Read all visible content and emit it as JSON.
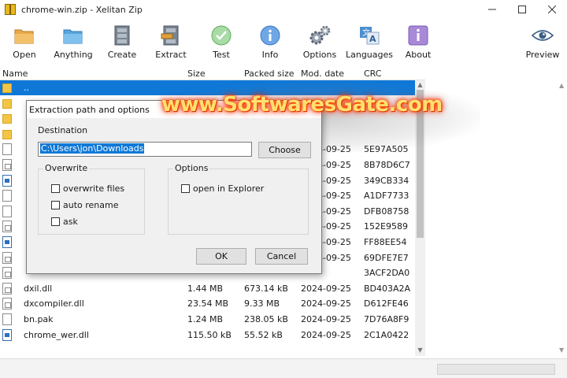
{
  "window": {
    "title": "chrome-win.zip - Xelitan Zip",
    "controls": [
      "minimize-icon",
      "maximize-icon",
      "close-icon"
    ]
  },
  "toolbar": {
    "buttons": [
      {
        "label": "Open",
        "icon": "folder-open-icon"
      },
      {
        "label": "Anything",
        "icon": "folder-anything-icon"
      },
      {
        "label": "Create",
        "icon": "cabinet-create-icon"
      },
      {
        "label": "Extract",
        "icon": "cabinet-extract-icon"
      },
      {
        "label": "Test",
        "icon": "check-circle-icon"
      },
      {
        "label": "Info",
        "icon": "info-icon"
      },
      {
        "label": "Options",
        "icon": "gears-icon"
      },
      {
        "label": "Languages",
        "icon": "translate-icon"
      },
      {
        "label": "About",
        "icon": "about-icon"
      },
      {
        "label": "Preview",
        "icon": "eye-icon"
      }
    ]
  },
  "columns": [
    "Name",
    "Size",
    "Packed size",
    "Mod. date",
    "CRC"
  ],
  "files": [
    {
      "name": "..",
      "size": "",
      "packed": "",
      "date": "",
      "crc": "",
      "type": "folder",
      "selected": true
    },
    {
      "name": "",
      "size": "",
      "packed": "",
      "date": "",
      "crc": "",
      "type": "folder"
    },
    {
      "name": "",
      "size": "",
      "packed": "",
      "date": "",
      "crc": "",
      "type": "folder"
    },
    {
      "name": "",
      "size": "",
      "packed": "",
      "date": "",
      "crc": "",
      "type": "folder"
    },
    {
      "name": "",
      "size": "",
      "packed": "",
      "date": "2024-09-25",
      "crc": "5E97A505",
      "type": "file"
    },
    {
      "name": "",
      "size": "",
      "packed": "",
      "date": "2024-09-25",
      "crc": "8B78D6C7",
      "type": "dll"
    },
    {
      "name": "",
      "size": "",
      "packed": "",
      "date": "2024-09-25",
      "crc": "349CB334",
      "type": "exe"
    },
    {
      "name": "",
      "size": "",
      "packed": "",
      "date": "2024-09-25",
      "crc": "A1DF7733",
      "type": "file"
    },
    {
      "name": "",
      "size": "",
      "packed": "",
      "date": "2024-09-25",
      "crc": "DFB08758",
      "type": "file"
    },
    {
      "name": "",
      "size": "",
      "packed": "",
      "date": "2024-09-25",
      "crc": "152E9589",
      "type": "dll"
    },
    {
      "name": "",
      "size": "",
      "packed": "",
      "date": "2024-09-25",
      "crc": "FF88EE54",
      "type": "exe"
    },
    {
      "name": "",
      "size": "",
      "packed": "",
      "date": "2024-09-25",
      "crc": "69DFE7E7",
      "type": "dll"
    },
    {
      "name": "",
      "size": "",
      "packed": "",
      "date": "",
      "crc": "3ACF2DA0",
      "type": "dll"
    },
    {
      "name": "dxil.dll",
      "size": "1.44 MB",
      "packed": "673.14 kB",
      "date": "2024-09-25",
      "crc": "BD403A2A",
      "type": "dll"
    },
    {
      "name": "dxcompiler.dll",
      "size": "23.54 MB",
      "packed": "9.33 MB",
      "date": "2024-09-25",
      "crc": "D612FE46",
      "type": "dll"
    },
    {
      "name": "bn.pak",
      "size": "1.24 MB",
      "packed": "238.05 kB",
      "date": "2024-09-25",
      "crc": "7D76A8F9",
      "type": "file"
    },
    {
      "name": "chrome_wer.dll",
      "size": "115.50 kB",
      "packed": "55.52 kB",
      "date": "2024-09-25",
      "crc": "2C1A0422",
      "type": "exe"
    }
  ],
  "dialog": {
    "title": "Extraction path and options",
    "destination_label": "Destination",
    "path_value": "C:\\Users\\jon\\Downloads",
    "choose_label": "Choose",
    "overwrite": {
      "title": "Overwrite",
      "options": [
        "overwrite files",
        "auto rename",
        "ask"
      ]
    },
    "options": {
      "title": "Options",
      "items": [
        "open in Explorer"
      ]
    },
    "ok_label": "OK",
    "cancel_label": "Cancel"
  },
  "watermark": "www.SoftwaresGate.com",
  "colors": {
    "selection": "#0f78d7",
    "dialog_bg": "#f0f0f0",
    "watermark": "#ffe070"
  }
}
